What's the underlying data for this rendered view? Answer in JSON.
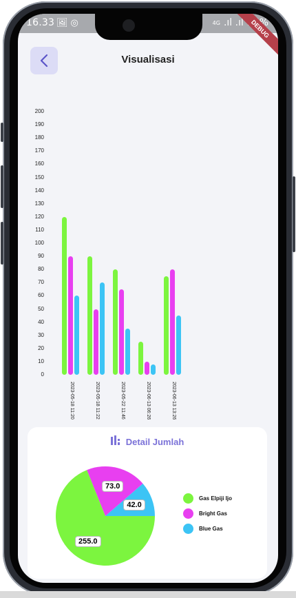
{
  "status_bar": {
    "time": "16.33",
    "left_icons": [
      "image-icon",
      "instagram-icon"
    ],
    "right_text": "95%",
    "signal_text": "4G",
    "debug_label": "DEBUG"
  },
  "header": {
    "title": "Visualisasi",
    "back_icon": "chevron-left-icon"
  },
  "chart_data": {
    "type": "bar",
    "categories": [
      "2023-05-18 11:20",
      "2023-05-18 11:22",
      "2023-05-22 11:46",
      "2023-06-13 06:26",
      "2023-06-13 13:26"
    ],
    "series": [
      {
        "name": "Gas Elpiji Ijo",
        "color": "#7cf53f",
        "values": [
          120,
          90,
          80,
          25,
          75
        ]
      },
      {
        "name": "Bright Gas",
        "color": "#e83ff0",
        "values": [
          90,
          50,
          65,
          10,
          80
        ]
      },
      {
        "name": "Blue Gas",
        "color": "#3cc4f5",
        "values": [
          60,
          70,
          35,
          8,
          45
        ]
      }
    ],
    "y_ticks": [
      0,
      10,
      20,
      30,
      40,
      50,
      60,
      70,
      80,
      90,
      100,
      110,
      120,
      130,
      140,
      150,
      160,
      170,
      180,
      190,
      200
    ],
    "ylim": [
      0,
      200
    ],
    "grid": false,
    "legend": "none"
  },
  "detail": {
    "title": "Detail Jumlah",
    "icon": "bar-chart-icon",
    "pie": {
      "type": "pie",
      "slices": [
        {
          "name": "Gas Elpiji Ijo",
          "value": 255.0,
          "label": "255.0",
          "color": "#7cf53f"
        },
        {
          "name": "Bright Gas",
          "value": 73.0,
          "label": "73.0",
          "color": "#e83ff0"
        },
        {
          "name": "Blue Gas",
          "value": 42.0,
          "label": "42.0",
          "color": "#3cc4f5"
        }
      ]
    },
    "legend": [
      {
        "label": "Gas Elpiji Ijo",
        "color": "#7cf53f"
      },
      {
        "label": "Bright Gas",
        "color": "#e83ff0"
      },
      {
        "label": "Blue Gas",
        "color": "#3cc4f5"
      }
    ]
  }
}
